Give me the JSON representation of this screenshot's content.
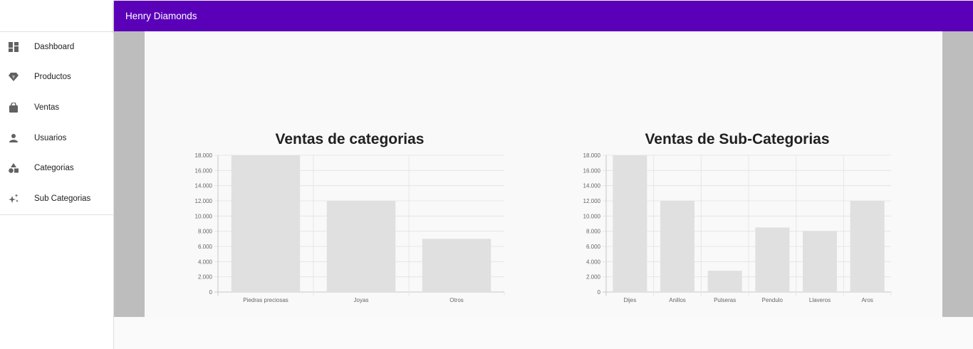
{
  "app": {
    "title": "Henry Diamonds"
  },
  "sidebar": {
    "items": [
      {
        "label": "Dashboard",
        "icon": "dashboard-icon"
      },
      {
        "label": "Productos",
        "icon": "diamond-icon"
      },
      {
        "label": "Ventas",
        "icon": "shopping-bag-icon"
      },
      {
        "label": "Usuarios",
        "icon": "person-icon"
      },
      {
        "label": "Categorias",
        "icon": "category-icon"
      },
      {
        "label": "Sub Categorias",
        "icon": "sparkles-icon"
      }
    ]
  },
  "colors": {
    "appbar": "#5a00b8",
    "bar": "#e0e0e0"
  },
  "chart_data": [
    {
      "type": "bar",
      "title": "Ventas de categorias",
      "categories": [
        "Piedras preciosas",
        "Joyas",
        "Otros"
      ],
      "values": [
        18000,
        12000,
        7000
      ],
      "ylim": [
        0,
        18000
      ],
      "yticks": [
        "0",
        "2.000",
        "4.000",
        "6.000",
        "8.000",
        "10.000",
        "12.000",
        "14.000",
        "16.000",
        "18.000"
      ],
      "grid": true
    },
    {
      "type": "bar",
      "title": "Ventas de Sub-Categorias",
      "categories": [
        "Dijes",
        "Anillos",
        "Pulseras",
        "Pendulo",
        "Llaveros",
        "Aros"
      ],
      "values": [
        18000,
        12000,
        2800,
        8500,
        8000,
        12000
      ],
      "ylim": [
        0,
        18000
      ],
      "yticks": [
        "0",
        "2.000",
        "4.000",
        "6.000",
        "8.000",
        "10.000",
        "12.000",
        "14.000",
        "16.000",
        "18.000"
      ],
      "grid": true
    }
  ]
}
